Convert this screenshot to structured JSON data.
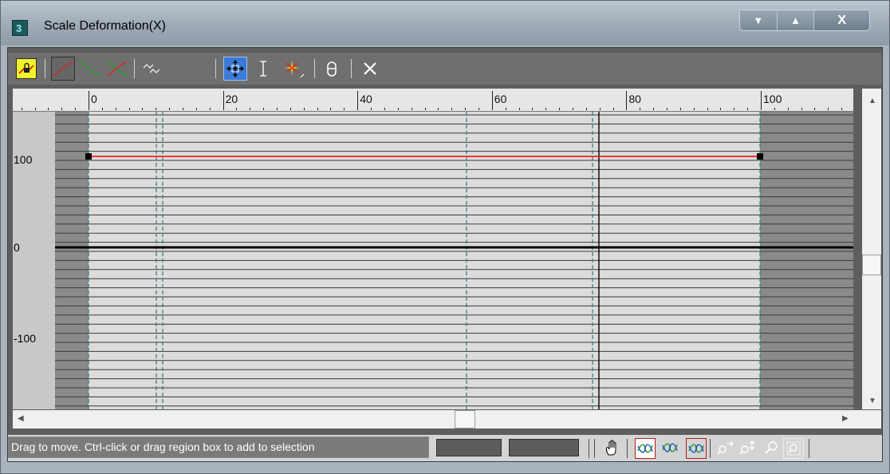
{
  "window": {
    "title": "Scale Deformation(X)",
    "app_icon_glyph": "3",
    "controls": {
      "minimize": "▼",
      "maximize": "▲",
      "close": "X"
    }
  },
  "toolbar": {
    "items": [
      {
        "name": "lock-aspect-button",
        "icon": "lock-icon"
      },
      {
        "name": "display-x-axis-button",
        "icon": "red-curve-icon"
      },
      {
        "name": "display-y-axis-button",
        "icon": "green-curve-icon"
      },
      {
        "name": "display-xy-axes-button",
        "icon": "red-green-curve-icon"
      },
      {
        "name": "swap-curves-button",
        "icon": "swap-curves-icon"
      },
      {
        "name": "move-control-point-button",
        "icon": "move-icon",
        "active": true
      },
      {
        "name": "scale-control-point-button",
        "icon": "scale-vertical-icon"
      },
      {
        "name": "insert-corner-point-button",
        "icon": "insert-point-icon"
      },
      {
        "name": "delete-control-point-button",
        "icon": "delete-point-icon"
      },
      {
        "name": "reset-curve-button",
        "icon": "reset-x-icon"
      }
    ]
  },
  "ruler": {
    "labels": [
      "0",
      "20",
      "40",
      "60",
      "80",
      "100"
    ]
  },
  "yaxis": {
    "labels": [
      "100",
      "0",
      "-100"
    ]
  },
  "status": {
    "message": "Drag to move. Ctrl-click or drag region box to add to selection",
    "field1": "",
    "field2": ""
  },
  "colors": {
    "curve": "#ff0000",
    "zero_line": "#000000",
    "dashed_lines": "#2f7a7a",
    "active_button": "#3b7ad6",
    "lock_button": "#f2f22a"
  }
}
